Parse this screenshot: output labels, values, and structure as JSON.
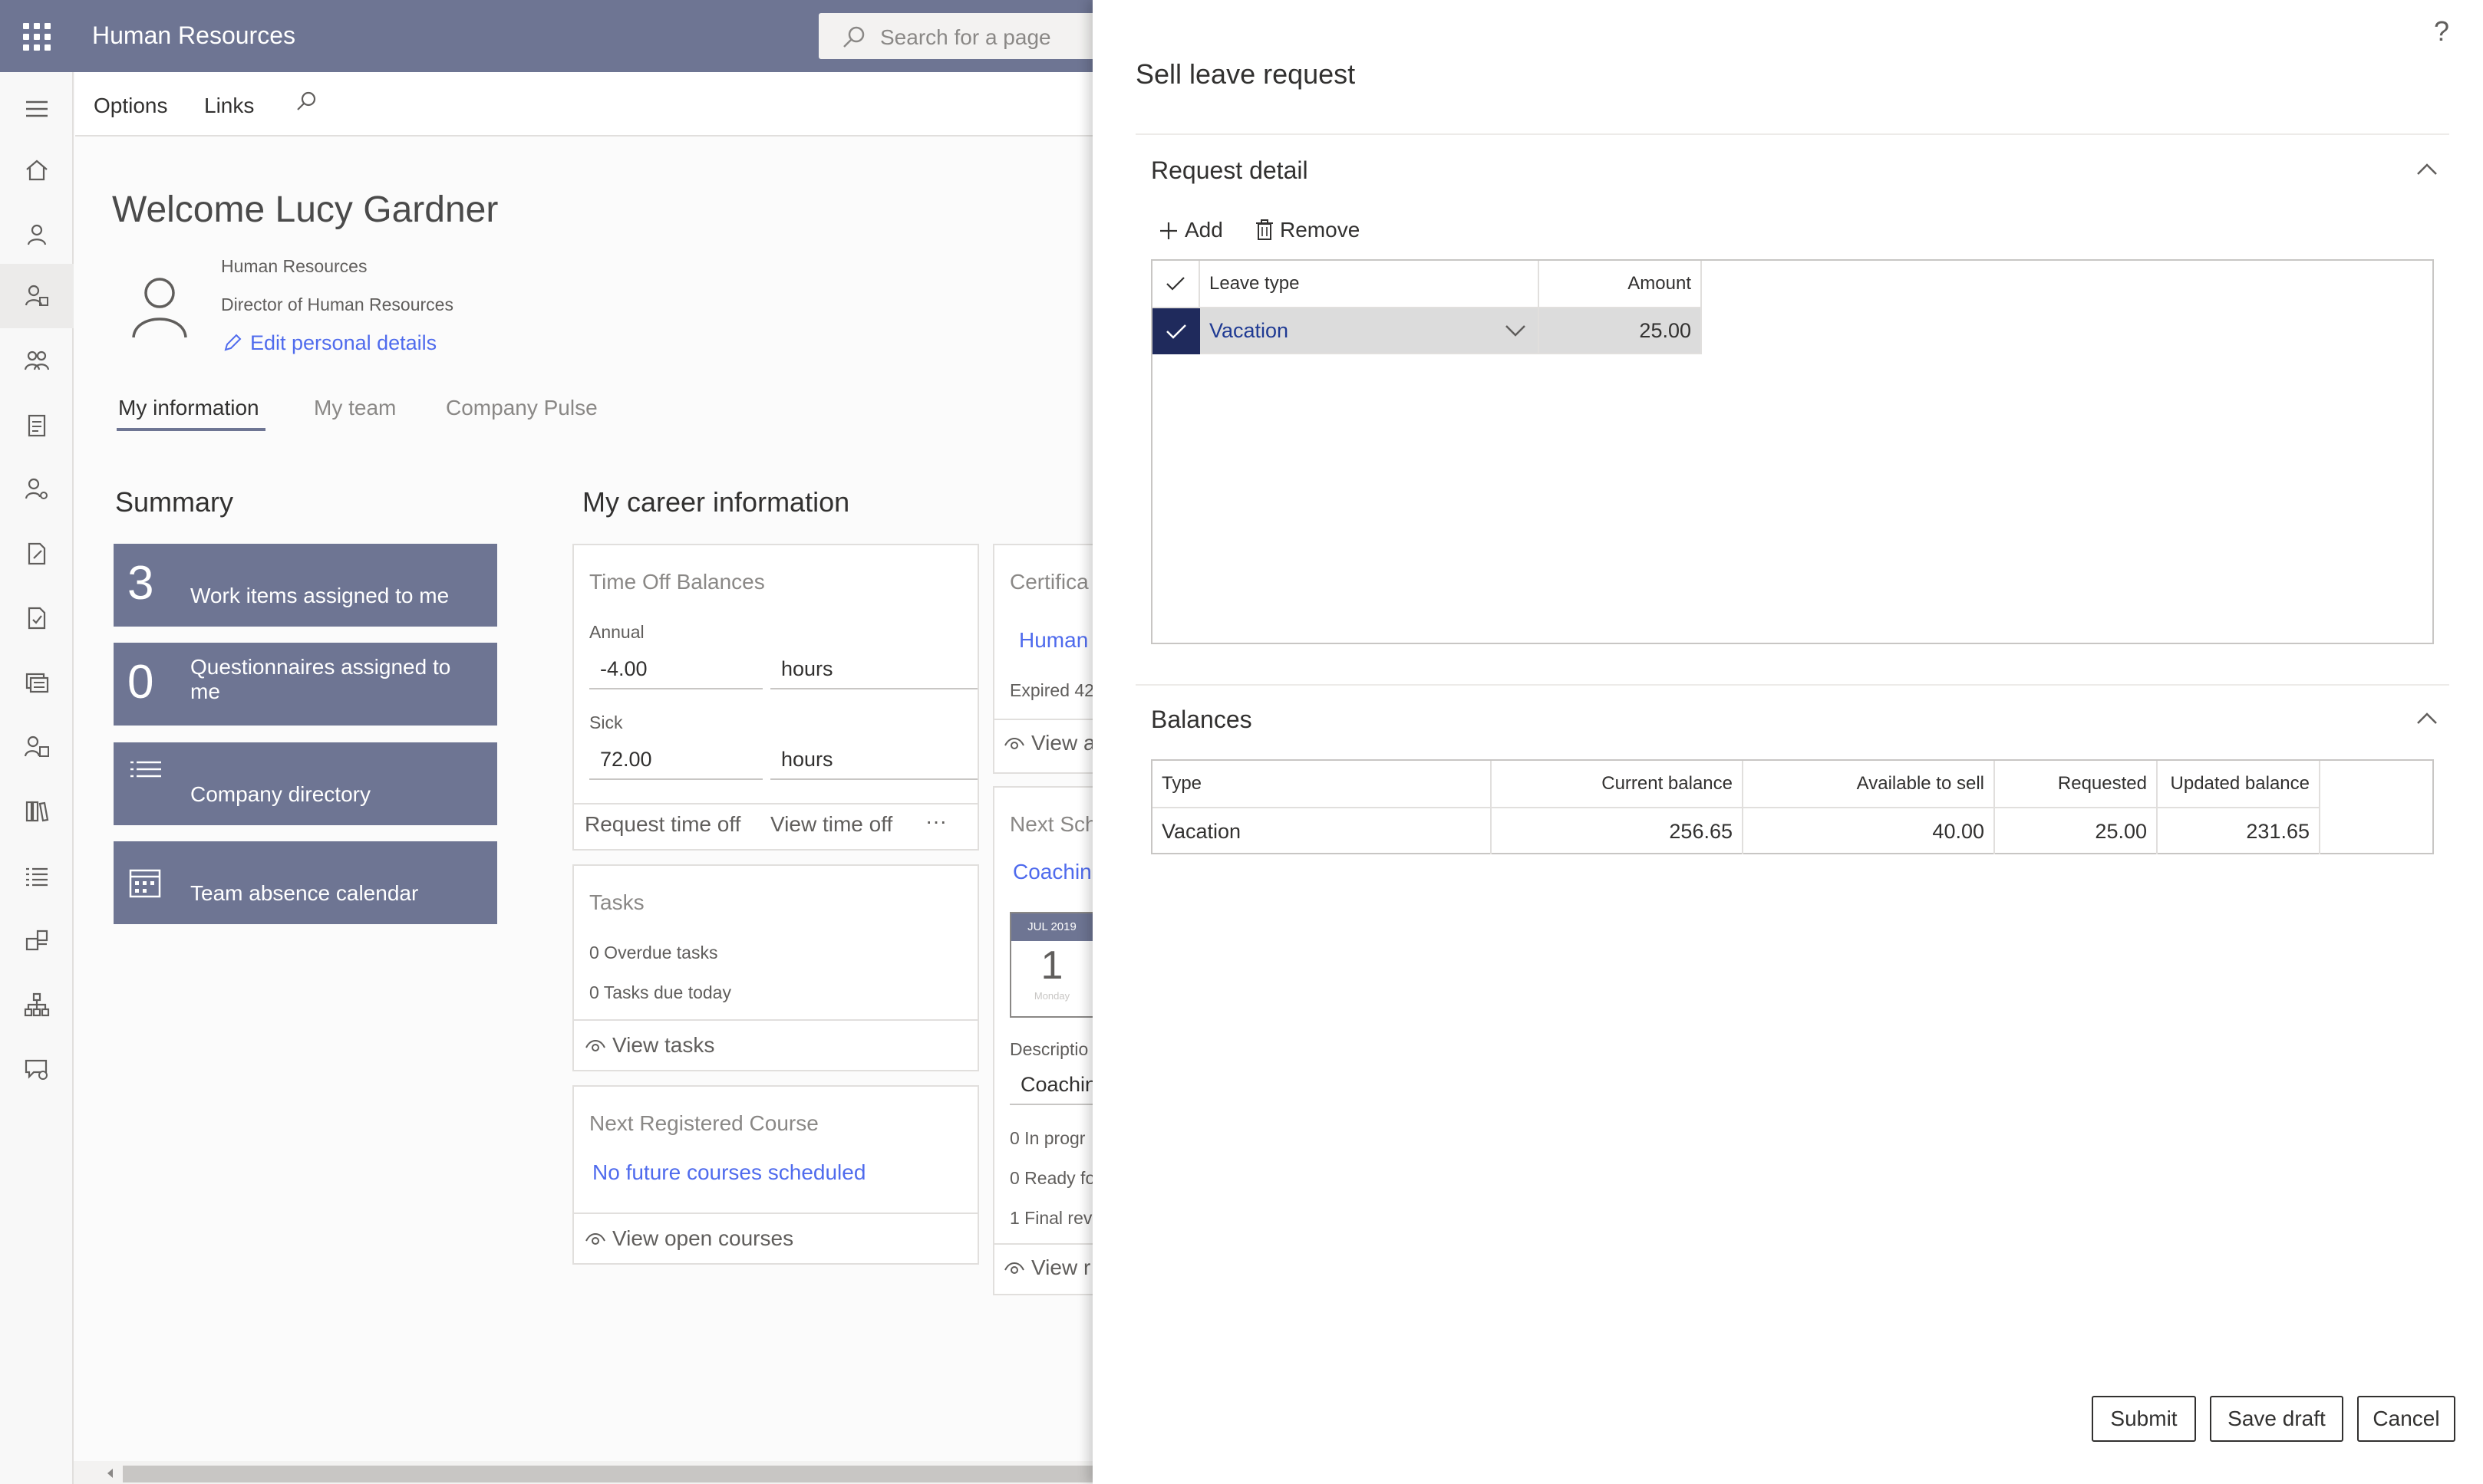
{
  "app": {
    "title": "Human Resources",
    "search_placeholder": "Search for a page"
  },
  "actionbar": {
    "options_label": "Options",
    "links_label": "Links"
  },
  "profile": {
    "welcome": "Welcome Lucy Gardner",
    "department": "Human Resources",
    "job_title": "Director of Human Resources",
    "edit_link": "Edit personal details"
  },
  "page_tabs": [
    "My information",
    "My team",
    "Company Pulse"
  ],
  "summary": {
    "heading": "Summary",
    "tiles": [
      {
        "count": "3",
        "label": "Work items assigned to me",
        "icon": "count"
      },
      {
        "count": "0",
        "label": "Questionnaires assigned to me",
        "icon": "count"
      },
      {
        "count": "",
        "label": "Company directory",
        "icon": "list-icon"
      },
      {
        "count": "",
        "label": "Team absence calendar",
        "icon": "calendar-icon"
      }
    ]
  },
  "career": {
    "heading": "My career information",
    "time_off": {
      "title": "Time Off Balances",
      "annual_label": "Annual",
      "annual_value": "-4.00",
      "annual_unit": "hours",
      "sick_label": "Sick",
      "sick_value": "72.00",
      "sick_unit": "hours",
      "request_link": "Request time off",
      "view_link": "View time off",
      "more": "···"
    },
    "tasks": {
      "title": "Tasks",
      "overdue": "0 Overdue tasks",
      "due_today": "0 Tasks due today",
      "view_link": "View tasks"
    },
    "course": {
      "title": "Next Registered Course",
      "link": "No future courses scheduled",
      "view_link": "View open courses"
    },
    "cert": {
      "title": "Certifica",
      "link": "Human",
      "expired": "Expired 42",
      "view_link": "View a"
    },
    "next": {
      "title": "Next Sch",
      "link": "Coachin",
      "cal_month": "JUL 2019",
      "cal_day": "1",
      "cal_weekday": "Monday",
      "desc_label": "Descriptio",
      "desc_value": "Coachin",
      "in_progress": "0 In progr",
      "ready": "0 Ready fo",
      "final": "1 Final rev",
      "view_link": "View r"
    }
  },
  "panel": {
    "help": "?",
    "title": "Sell leave request",
    "request_detail": {
      "heading": "Request detail",
      "add_label": "Add",
      "remove_label": "Remove",
      "col_leave_type": "Leave type",
      "col_amount": "Amount",
      "rows": [
        {
          "leave_type": "Vacation",
          "amount": "25.00"
        }
      ]
    },
    "balances": {
      "heading": "Balances",
      "columns": [
        "Type",
        "Current balance",
        "Available to sell",
        "Requested",
        "Updated balance"
      ],
      "rows": [
        {
          "type": "Vacation",
          "current": "256.65",
          "available": "40.00",
          "requested": "25.00",
          "updated": "231.65"
        }
      ]
    },
    "buttons": {
      "submit": "Submit",
      "save_draft": "Save draft",
      "cancel": "Cancel"
    }
  }
}
